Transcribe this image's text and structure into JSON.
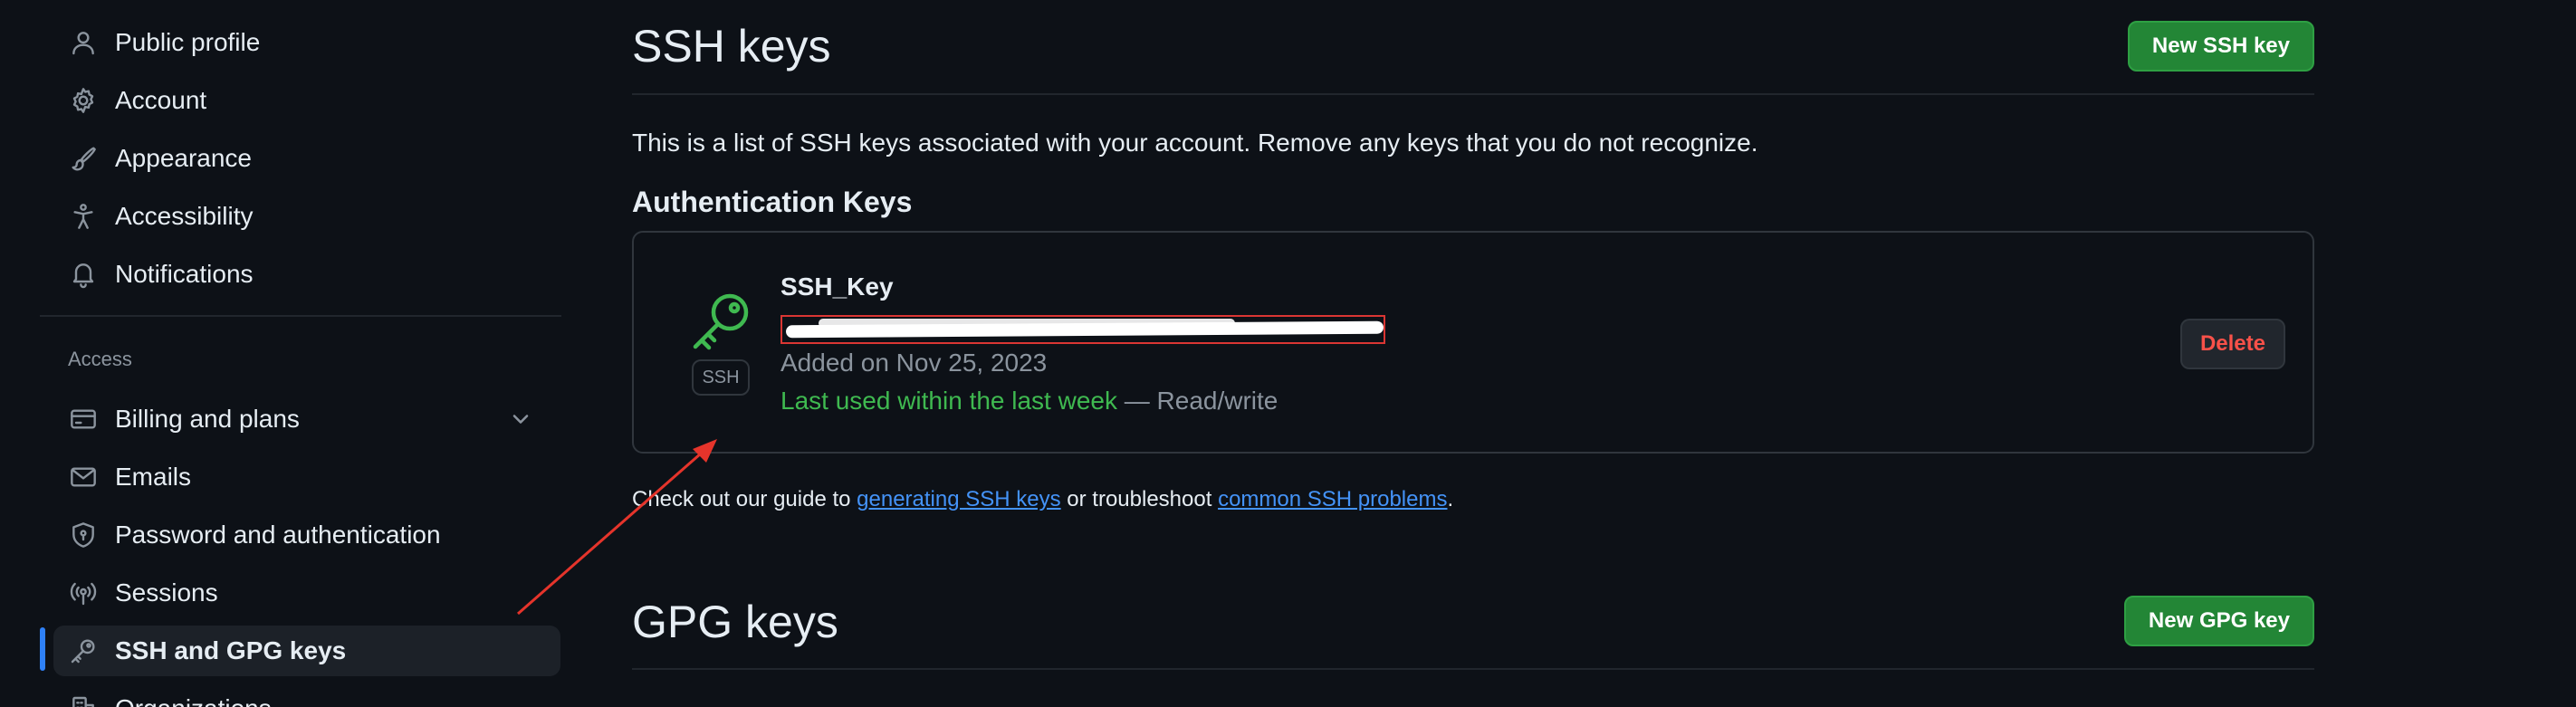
{
  "sidebar": {
    "items": [
      {
        "label": "Public profile",
        "icon": "person-icon"
      },
      {
        "label": "Account",
        "icon": "gear-icon"
      },
      {
        "label": "Appearance",
        "icon": "paintbrush-icon"
      },
      {
        "label": "Accessibility",
        "icon": "accessibility-icon"
      },
      {
        "label": "Notifications",
        "icon": "bell-icon"
      }
    ],
    "access_heading": "Access",
    "access_items": [
      {
        "label": "Billing and plans",
        "icon": "credit-card-icon"
      },
      {
        "label": "Emails",
        "icon": "mail-icon"
      },
      {
        "label": "Password and authentication",
        "icon": "shield-lock-icon"
      },
      {
        "label": "Sessions",
        "icon": "broadcast-icon"
      },
      {
        "label": "SSH and GPG keys",
        "icon": "key-icon"
      },
      {
        "label": "Organizations",
        "icon": "organization-icon"
      }
    ]
  },
  "ssh": {
    "title": "SSH keys",
    "new_button": "New SSH key",
    "intro": "This is a list of SSH keys associated with your account. Remove any keys that you do not recognize.",
    "auth_heading": "Authentication Keys",
    "key": {
      "name": "SSH_Key",
      "badge": "SSH",
      "added": "Added on Nov 25, 2023",
      "last_used": "Last used within the last week",
      "access": " — Read/write",
      "delete_button": "Delete"
    },
    "guide": {
      "prefix": "Check out our guide to ",
      "link1": "generating SSH keys",
      "middle": " or troubleshoot ",
      "link2": "common SSH problems",
      "suffix": "."
    }
  },
  "gpg": {
    "title": "GPG keys",
    "new_button": "New GPG key"
  },
  "colors": {
    "background": "#0d1117",
    "accent_blue": "#2f81f7",
    "green_button": "#238636",
    "delete_red": "#f85149",
    "annotation_red": "#e5342b"
  }
}
